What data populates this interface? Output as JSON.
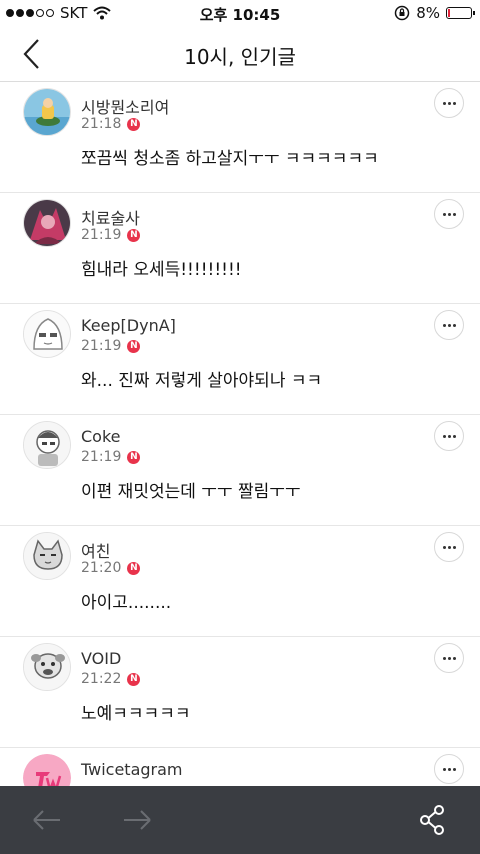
{
  "status": {
    "carrier": "SKT",
    "time": "오후 10:45",
    "battery": "8%",
    "signal_bars": 3,
    "battery_level": 0.08
  },
  "header": {
    "title": "10시, 인기글"
  },
  "comments": [
    {
      "name": "시방뭔소리여",
      "time": "21:18",
      "badge": "N",
      "text": "쪼끔씩 청소좀 하고살지ㅜㅜ ㅋㅋㅋㅋㅋㅋ"
    },
    {
      "name": "치료술사",
      "time": "21:19",
      "badge": "N",
      "text": "힘내라 오세득!!!!!!!!!"
    },
    {
      "name": "Keep[DynA]",
      "time": "21:19",
      "badge": "N",
      "text": "와... 진짜 저렇게 살아야되나 ㅋㅋ"
    },
    {
      "name": "Coke",
      "time": "21:19",
      "badge": "N",
      "text": "이편 재밋엇는데 ㅜㅜ 짤림ㅜㅜ"
    },
    {
      "name": "여친",
      "time": "21:20",
      "badge": "N",
      "text": "아이고........"
    },
    {
      "name": "VOID",
      "time": "21:22",
      "badge": "N",
      "text": "노예ㅋㅋㅋㅋㅋ"
    },
    {
      "name": "Twicetagram",
      "time": "",
      "badge": "",
      "text": ""
    }
  ],
  "colors": {
    "badge": "#e8334b",
    "toolbar": "#3a3d42",
    "battery_low": "#e0233a"
  },
  "icons": {
    "back": "chevron-left-icon",
    "more": "more-horizontal-icon",
    "prev": "arrow-left-icon",
    "next": "arrow-right-icon",
    "share": "share-icon"
  }
}
